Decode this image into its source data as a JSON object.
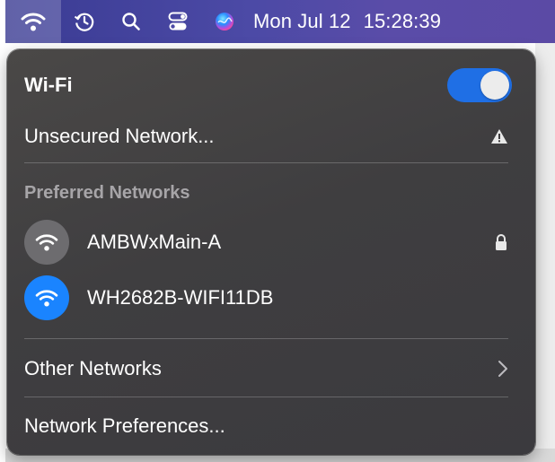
{
  "menubar": {
    "wifi_icon": "wifi-icon",
    "time_machine_icon": "time-machine-icon",
    "search_icon": "search-icon",
    "control_center_icon": "control-center-icon",
    "siri_icon": "siri-icon",
    "day_date": "Mon Jul 12",
    "time": "15:28:39"
  },
  "wifi_menu": {
    "title": "Wi-Fi",
    "toggle_on": true,
    "current_network": {
      "label": "Unsecured Network...",
      "icon": "warning-icon"
    },
    "preferred_section_title": "Preferred Networks",
    "preferred_networks": [
      {
        "name": "AMBWxMain-A",
        "icon": "wifi-icon",
        "secured": true,
        "connected": false
      },
      {
        "name": "WH2682B-WIFI11DB",
        "icon": "wifi-icon",
        "secured": false,
        "connected": true
      }
    ],
    "other_networks_label": "Other Networks",
    "network_preferences_label": "Network Preferences..."
  },
  "colors": {
    "menubar": "#4c4aa6",
    "toggle_on": "#1f6fe5",
    "connected_network": "#1a84ff",
    "panel_background": "#3f3e40",
    "section_title": "#a7a5a8"
  }
}
